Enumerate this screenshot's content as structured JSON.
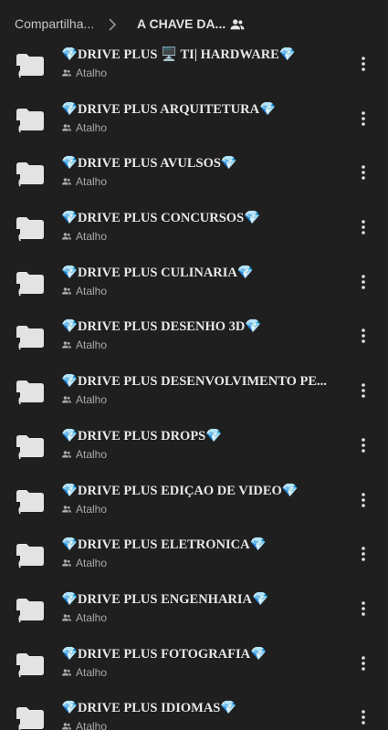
{
  "breadcrumb": {
    "root": "Compartilha...",
    "current": "A CHAVE DA..."
  },
  "icons": {
    "separator": "chevron-right-icon",
    "shared": "people-icon",
    "folder": "shortcut-folder-icon",
    "subtitle": "people-icon",
    "menu": "more-vert-icon"
  },
  "items": [
    {
      "name": "💎DRIVE PLUS 🖥️ TI| HARDWARE💎",
      "subtitle": "Atalho"
    },
    {
      "name": "💎DRIVE PLUS ARQUITETURA💎",
      "subtitle": "Atalho"
    },
    {
      "name": "💎DRIVE PLUS AVULSOS💎",
      "subtitle": "Atalho"
    },
    {
      "name": "💎DRIVE PLUS CONCURSOS💎",
      "subtitle": "Atalho"
    },
    {
      "name": "💎DRIVE PLUS CULINARIA💎",
      "subtitle": "Atalho"
    },
    {
      "name": "💎DRIVE PLUS DESENHO 3D💎",
      "subtitle": "Atalho"
    },
    {
      "name": "💎DRIVE PLUS DESENVOLVIMENTO PE...",
      "subtitle": "Atalho"
    },
    {
      "name": "💎DRIVE PLUS DROPS💎",
      "subtitle": "Atalho"
    },
    {
      "name": "💎DRIVE PLUS EDIÇAO DE VIDEO💎",
      "subtitle": "Atalho"
    },
    {
      "name": "💎DRIVE PLUS ELETRONICA💎",
      "subtitle": "Atalho"
    },
    {
      "name": "💎DRIVE PLUS ENGENHARIA💎",
      "subtitle": "Atalho"
    },
    {
      "name": "💎DRIVE PLUS FOTOGRAFIA💎",
      "subtitle": "Atalho"
    },
    {
      "name": "💎DRIVE PLUS IDIOMAS💎",
      "subtitle": "Atalho"
    }
  ]
}
